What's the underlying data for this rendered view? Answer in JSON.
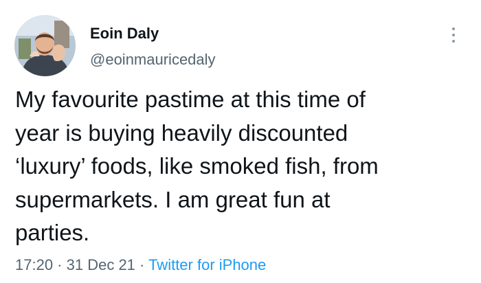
{
  "author": {
    "display_name": "Eoin Daly",
    "handle": "@eoinmauricedaly"
  },
  "tweet": {
    "lines": [
      "My favourite pastime at this time of",
      "year is buying heavily discounted",
      "‘luxury’ foods, like smoked fish, from",
      "supermarkets. I am great fun at",
      "parties."
    ]
  },
  "meta": {
    "time": "17:20",
    "separator": " · ",
    "date": "31 Dec 21",
    "source": "Twitter for iPhone"
  },
  "icons": {
    "more": "more-vertical-icon"
  },
  "colors": {
    "text": "#0f1419",
    "secondary": "#536471",
    "link": "#1d9bf0"
  }
}
